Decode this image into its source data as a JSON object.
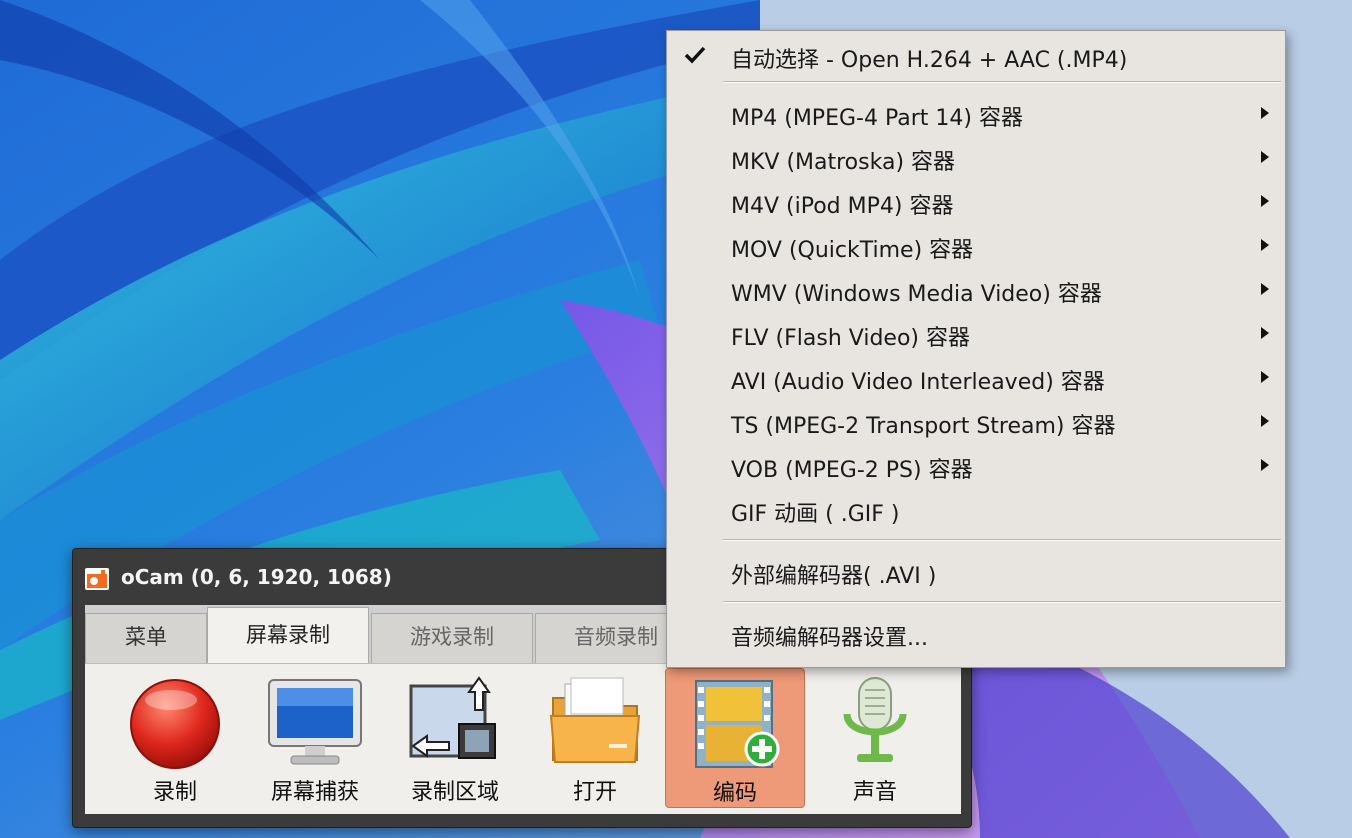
{
  "window": {
    "title": "oCam (0, 6, 1920, 1068)",
    "tabs": [
      {
        "label": "菜单"
      },
      {
        "label": "屏幕录制"
      },
      {
        "label": "游戏录制"
      },
      {
        "label": "音频录制"
      }
    ],
    "toolbar": [
      {
        "label": "录制",
        "icon": "record-icon"
      },
      {
        "label": "屏幕捕获",
        "icon": "monitor-icon"
      },
      {
        "label": "录制区域",
        "icon": "resize-region-icon"
      },
      {
        "label": "打开",
        "icon": "folder-icon"
      },
      {
        "label": "编码",
        "icon": "film-add-icon"
      },
      {
        "label": "声音",
        "icon": "microphone-icon"
      }
    ],
    "active_tab": "屏幕录制",
    "selected_tool": "编码"
  },
  "menu": {
    "checked_item": "自动选择 - Open H.264 + AAC (.MP4)",
    "items": [
      {
        "label": "MP4 (MPEG-4 Part 14) 容器"
      },
      {
        "label": "MKV (Matroska) 容器"
      },
      {
        "label": "M4V (iPod MP4) 容器"
      },
      {
        "label": "MOV (QuickTime) 容器"
      },
      {
        "label": "WMV (Windows Media Video) 容器"
      },
      {
        "label": "FLV (Flash Video) 容器"
      },
      {
        "label": "AVI (Audio Video Interleaved) 容器"
      },
      {
        "label": "TS (MPEG-2 Transport Stream) 容器"
      },
      {
        "label": "VOB (MPEG-2 PS) 容器"
      },
      {
        "label": "GIF 动画 ( .GIF )"
      }
    ],
    "external_codec": "外部编解码器( .AVI )",
    "audio_codec_settings": "音频编解码器设置..."
  },
  "colors": {
    "selected_tool_bg": "#ee9977",
    "menu_bg": "#e8e5e1",
    "record_red": "#e0281e"
  }
}
